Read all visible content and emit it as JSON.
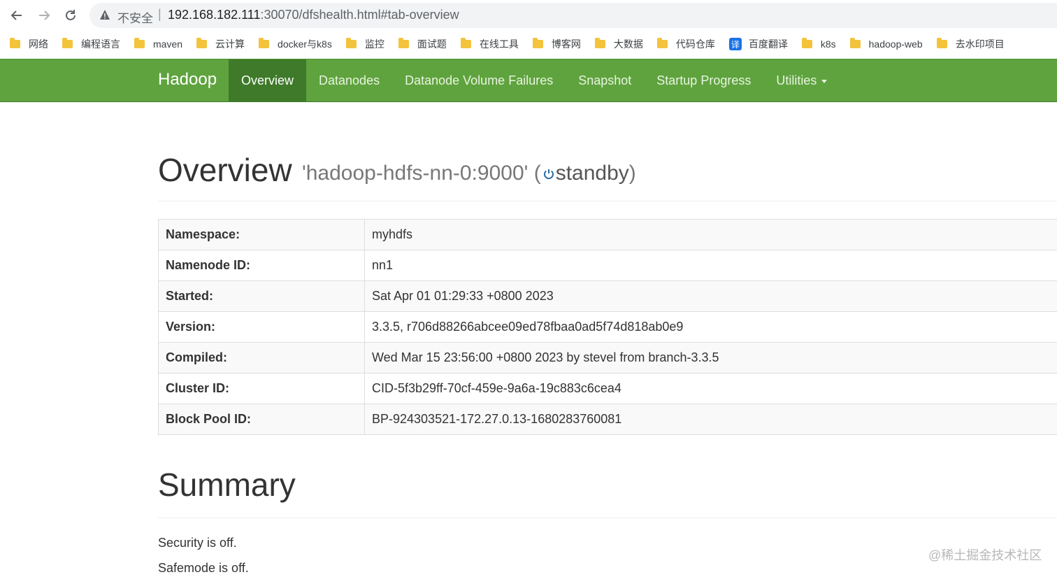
{
  "browser": {
    "insecure_label": "不安全",
    "url_host": "192.168.182.111",
    "url_rest": ":30070/dfshealth.html#tab-overview"
  },
  "bookmarks": [
    {
      "label": "网络",
      "icon": "folder-icon"
    },
    {
      "label": "编程语言",
      "icon": "folder-icon"
    },
    {
      "label": "maven",
      "icon": "folder-icon"
    },
    {
      "label": "云计算",
      "icon": "folder-icon"
    },
    {
      "label": "docker与k8s",
      "icon": "folder-icon"
    },
    {
      "label": "监控",
      "icon": "folder-icon"
    },
    {
      "label": "面试题",
      "icon": "folder-icon"
    },
    {
      "label": "在线工具",
      "icon": "folder-icon"
    },
    {
      "label": "博客网",
      "icon": "folder-icon"
    },
    {
      "label": "大数据",
      "icon": "folder-icon"
    },
    {
      "label": "代码仓库",
      "icon": "folder-icon"
    },
    {
      "label": "百度翻译",
      "icon": "translate-icon",
      "icon_text": "译"
    },
    {
      "label": "k8s",
      "icon": "folder-icon"
    },
    {
      "label": "hadoop-web",
      "icon": "folder-icon"
    },
    {
      "label": "去水印项目",
      "icon": "folder-icon"
    }
  ],
  "navbar": {
    "brand": "Hadoop",
    "items": [
      "Overview",
      "Datanodes",
      "Datanode Volume Failures",
      "Snapshot",
      "Startup Progress",
      "Utilities"
    ],
    "active_index": 0,
    "color": "#5fa33e"
  },
  "overview": {
    "title": "Overview",
    "host": "'hadoop-hdfs-nn-0:9000'",
    "state": "standby",
    "rows": [
      {
        "label": "Namespace:",
        "value": "myhdfs"
      },
      {
        "label": "Namenode ID:",
        "value": "nn1"
      },
      {
        "label": "Started:",
        "value": "Sat Apr 01 01:29:33 +0800 2023"
      },
      {
        "label": "Version:",
        "value": "3.3.5, r706d88266abcee09ed78fbaa0ad5f74d818ab0e9"
      },
      {
        "label": "Compiled:",
        "value": "Wed Mar 15 23:56:00 +0800 2023 by stevel from branch-3.3.5"
      },
      {
        "label": "Cluster ID:",
        "value": "CID-5f3b29ff-70cf-459e-9a6a-19c883c6cea4"
      },
      {
        "label": "Block Pool ID:",
        "value": "BP-924303521-172.27.0.13-1680283760081"
      }
    ]
  },
  "summary": {
    "title": "Summary",
    "lines": [
      "Security is off.",
      "Safemode is off."
    ]
  },
  "watermark": "@稀土掘金技术社区"
}
